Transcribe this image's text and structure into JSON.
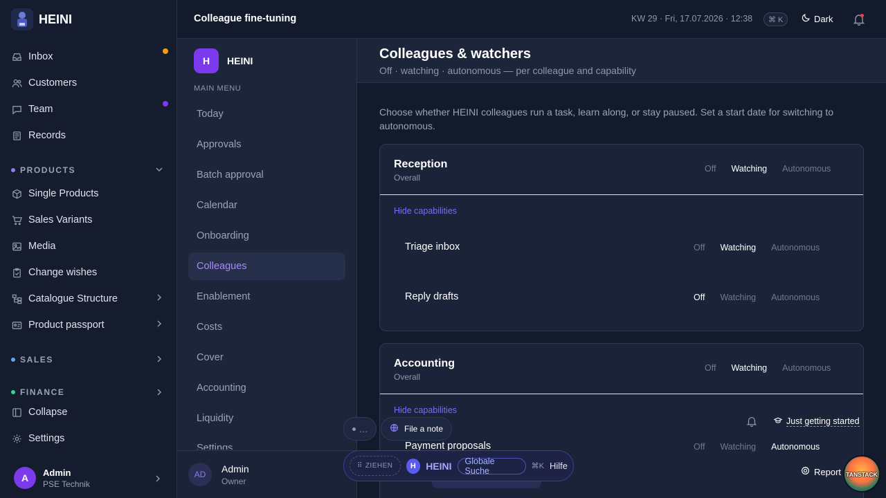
{
  "app": {
    "name": "HEINI"
  },
  "sidebar": {
    "items": [
      {
        "label": "Inbox"
      },
      {
        "label": "Customers"
      },
      {
        "label": "Team"
      },
      {
        "label": "Records"
      }
    ],
    "products_section": "PRODUCTS",
    "product_items": [
      {
        "label": "Single Products"
      },
      {
        "label": "Sales Variants"
      },
      {
        "label": "Media"
      },
      {
        "label": "Change wishes"
      },
      {
        "label": "Catalogue Structure"
      },
      {
        "label": "Product passport"
      }
    ],
    "sales_section": "SALES",
    "finance_section": "FINANCE",
    "collapse": "Collapse",
    "settings": "Settings",
    "user": {
      "initial": "A",
      "name": "Admin",
      "org": "PSE Technik"
    },
    "colors": {
      "inbox_dot": "#f59e0b",
      "team_dot": "#7c3aed",
      "products_dot": "#8b7fe8",
      "sales_dot": "#60a5fa",
      "finance_dot": "#34d399"
    }
  },
  "topbar": {
    "title": "Colleague fine-tuning",
    "date": "KW 29 · Fri, 17.07.2026 · 12:38",
    "shortcut": "⌘ K",
    "theme": "Dark"
  },
  "submenu": {
    "logo_initial": "H",
    "title": "HEINI",
    "section_label": "MAIN MENU",
    "items": [
      {
        "label": "Today"
      },
      {
        "label": "Approvals"
      },
      {
        "label": "Batch approval"
      },
      {
        "label": "Calendar"
      },
      {
        "label": "Onboarding"
      },
      {
        "label": "Colleagues"
      },
      {
        "label": "Enablement"
      },
      {
        "label": "Costs"
      },
      {
        "label": "Cover"
      },
      {
        "label": "Accounting"
      },
      {
        "label": "Liquidity"
      },
      {
        "label": "Settings"
      }
    ],
    "active": "Colleagues",
    "user": {
      "initials": "AD",
      "name": "Admin",
      "role": "Owner"
    }
  },
  "main": {
    "title": "Colleagues & watchers",
    "subtitle": "Off · watching · autonomous — per colleague and capability",
    "intro": "Choose whether HEINI colleagues run a task, learn along, or stay paused. Set a start date for switching to autonomous.",
    "modes": {
      "off": "Off",
      "watching": "Watching",
      "autonomous": "Autonomous"
    },
    "hide_capabilities": "Hide capabilities",
    "cards": [
      {
        "title": "Reception",
        "subtitle": "Overall",
        "mode": "Watching",
        "capabilities": [
          {
            "label": "Triage inbox",
            "mode": "Watching"
          },
          {
            "label": "Reply drafts",
            "mode": "Off"
          }
        ]
      },
      {
        "title": "Accounting",
        "subtitle": "Overall",
        "mode": "Watching",
        "capabilities": [
          {
            "label": "Payment proposals",
            "mode": "Autonomous"
          }
        ]
      }
    ]
  },
  "floating": {
    "dots": "…",
    "note": "File a note",
    "drag": "ZIEHEN",
    "brand_initial": "H",
    "brand": "HEINI",
    "search": "Globale Suche",
    "shortcut": "⌘K",
    "help": "Hilfe",
    "getting_started": "Just getting started",
    "report": "Report",
    "tanstack": "TANSTACK"
  }
}
